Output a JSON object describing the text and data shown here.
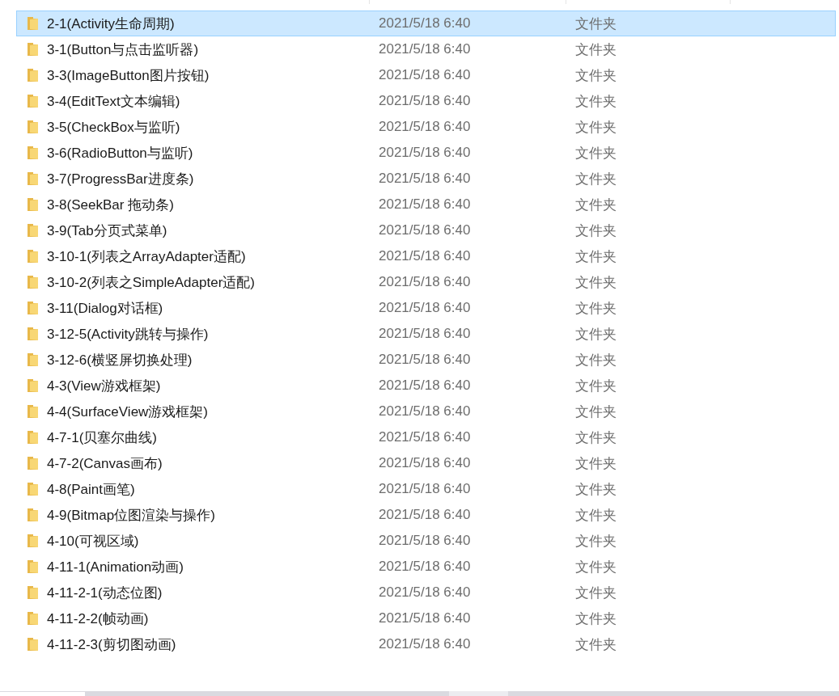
{
  "rows": [
    {
      "name": "2-1(Activity生命周期)",
      "date": "2021/5/18 6:40",
      "type": "文件夹",
      "selected": true
    },
    {
      "name": "3-1(Button与点击监听器)",
      "date": "2021/5/18 6:40",
      "type": "文件夹",
      "selected": false
    },
    {
      "name": "3-3(ImageButton图片按钮)",
      "date": "2021/5/18 6:40",
      "type": "文件夹",
      "selected": false
    },
    {
      "name": "3-4(EditText文本编辑)",
      "date": "2021/5/18 6:40",
      "type": "文件夹",
      "selected": false
    },
    {
      "name": "3-5(CheckBox与监听)",
      "date": "2021/5/18 6:40",
      "type": "文件夹",
      "selected": false
    },
    {
      "name": "3-6(RadioButton与监听)",
      "date": "2021/5/18 6:40",
      "type": "文件夹",
      "selected": false
    },
    {
      "name": "3-7(ProgressBar进度条)",
      "date": "2021/5/18 6:40",
      "type": "文件夹",
      "selected": false
    },
    {
      "name": "3-8(SeekBar 拖动条)",
      "date": "2021/5/18 6:40",
      "type": "文件夹",
      "selected": false
    },
    {
      "name": "3-9(Tab分页式菜单)",
      "date": "2021/5/18 6:40",
      "type": "文件夹",
      "selected": false
    },
    {
      "name": "3-10-1(列表之ArrayAdapter适配)",
      "date": "2021/5/18 6:40",
      "type": "文件夹",
      "selected": false
    },
    {
      "name": "3-10-2(列表之SimpleAdapter适配)",
      "date": "2021/5/18 6:40",
      "type": "文件夹",
      "selected": false
    },
    {
      "name": "3-11(Dialog对话框)",
      "date": "2021/5/18 6:40",
      "type": "文件夹",
      "selected": false
    },
    {
      "name": "3-12-5(Activity跳转与操作)",
      "date": "2021/5/18 6:40",
      "type": "文件夹",
      "selected": false
    },
    {
      "name": "3-12-6(横竖屏切换处理)",
      "date": "2021/5/18 6:40",
      "type": "文件夹",
      "selected": false
    },
    {
      "name": "4-3(View游戏框架)",
      "date": "2021/5/18 6:40",
      "type": "文件夹",
      "selected": false
    },
    {
      "name": "4-4(SurfaceView游戏框架)",
      "date": "2021/5/18 6:40",
      "type": "文件夹",
      "selected": false
    },
    {
      "name": "4-7-1(贝塞尔曲线)",
      "date": "2021/5/18 6:40",
      "type": "文件夹",
      "selected": false
    },
    {
      "name": "4-7-2(Canvas画布)",
      "date": "2021/5/18 6:40",
      "type": "文件夹",
      "selected": false
    },
    {
      "name": "4-8(Paint画笔)",
      "date": "2021/5/18 6:40",
      "type": "文件夹",
      "selected": false
    },
    {
      "name": "4-9(Bitmap位图渲染与操作)",
      "date": "2021/5/18 6:40",
      "type": "文件夹",
      "selected": false
    },
    {
      "name": "4-10(可视区域)",
      "date": "2021/5/18 6:40",
      "type": "文件夹",
      "selected": false
    },
    {
      "name": "4-11-1(Animation动画)",
      "date": "2021/5/18 6:40",
      "type": "文件夹",
      "selected": false
    },
    {
      "name": "4-11-2-1(动态位图)",
      "date": "2021/5/18 6:40",
      "type": "文件夹",
      "selected": false
    },
    {
      "name": "4-11-2-2(帧动画)",
      "date": "2021/5/18 6:40",
      "type": "文件夹",
      "selected": false
    },
    {
      "name": "4-11-2-3(剪切图动画)",
      "date": "2021/5/18 6:40",
      "type": "文件夹",
      "selected": false
    }
  ]
}
